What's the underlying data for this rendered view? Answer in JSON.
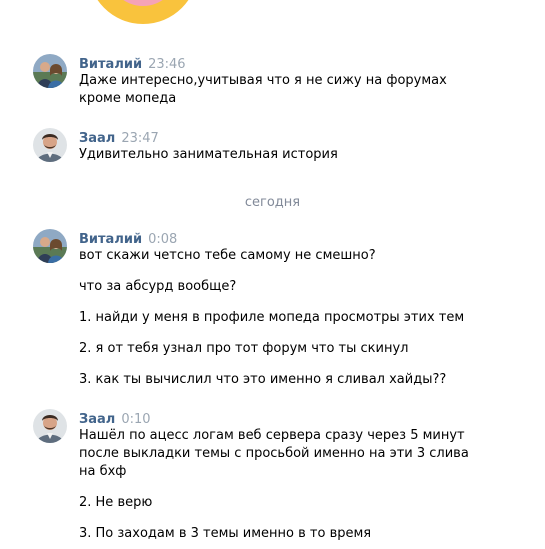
{
  "date_separator": "сегодня",
  "messages": [
    {
      "author": "Виталий",
      "time": "23:46",
      "lines": [
        "Даже интересно,учитывая что я не сижу на форумах",
        "кроме мопеда"
      ]
    },
    {
      "author": "Заал",
      "time": "23:47",
      "lines": [
        "Удивительно занимательная история"
      ]
    },
    {
      "author": "Виталий",
      "time": "0:08",
      "paragraphs": [
        "вот скажи четсно тебе самому не смешно?",
        "что за абсурд вообще?",
        "1. найди у меня в профиле мопеда просмотры этих тем",
        "2. я от тебя узнал про тот форум что ты скинул",
        "3. как ты вычислил что это именно я сливал хайды??"
      ]
    },
    {
      "author": "Заал",
      "time": "0:10",
      "paragraphs": [
        "Нашёл по ацесс логам веб сервера сразу через 5 минут",
        "после выкладки темы с просьбой именно на эти 3 слива",
        "на бхф",
        "2. Не верю",
        "3. По заходам в 3 темы именно в то время"
      ]
    }
  ]
}
